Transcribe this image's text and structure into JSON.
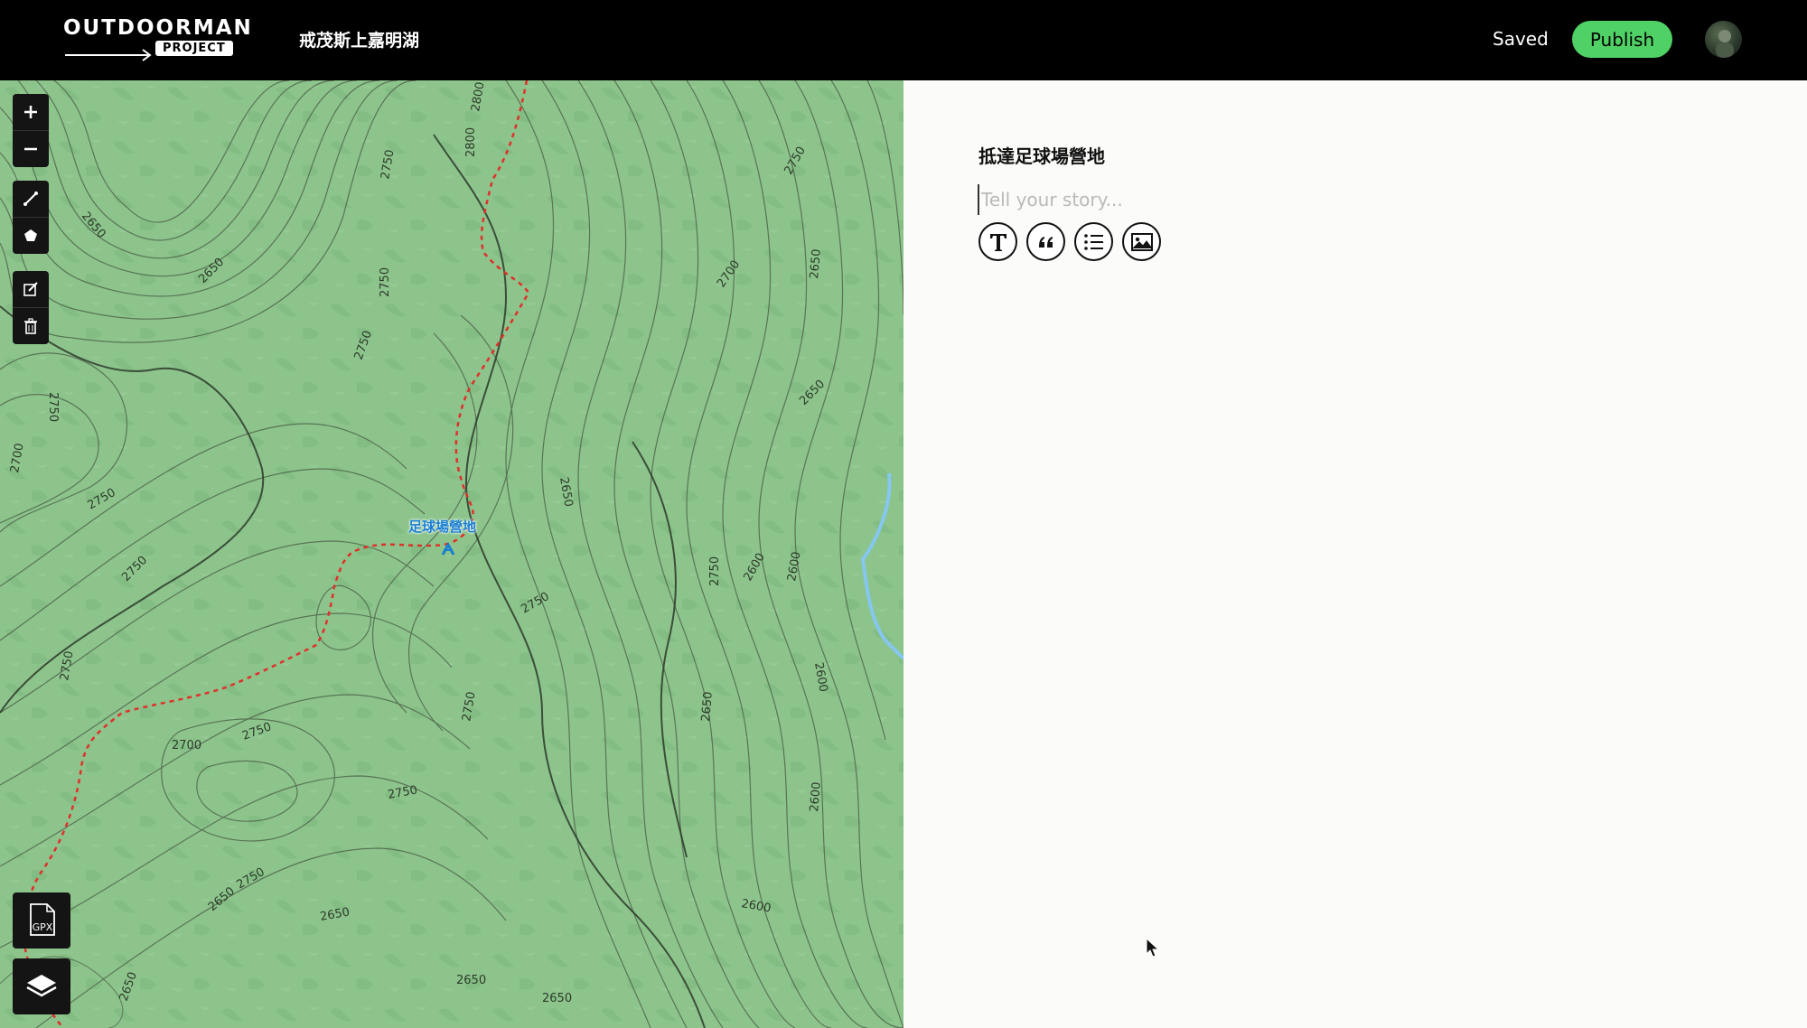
{
  "header": {
    "logo_main": "OUTDOORMAN",
    "logo_sub": "PROJECT",
    "trip_title": "戒茂斯上嘉明湖",
    "saved_label": "Saved",
    "publish_label": "Publish"
  },
  "map": {
    "toolbar": [
      "zoom-in-icon",
      "zoom-out-icon",
      "draw-line-icon",
      "draw-polygon-icon",
      "edit-icon",
      "trash-icon"
    ],
    "gpx_label": "GPX",
    "layers_icon": "layers-icon",
    "camp_label": "足球場營地",
    "contour_labels": [
      "2800",
      "2800",
      "2750",
      "2650",
      "2650",
      "2750",
      "2750",
      "2750",
      "2700",
      "2750",
      "2750",
      "2650",
      "2750",
      "2750",
      "2700",
      "2750",
      "2750",
      "2750",
      "2750",
      "2650",
      "2650",
      "2650",
      "2600",
      "2600",
      "2600",
      "2650",
      "2750",
      "2750",
      "2700",
      "2650",
      "2650",
      "2600",
      "2600",
      "2650",
      "2650"
    ],
    "colors": {
      "base": "#8cc48c",
      "contour": "#4a5a44",
      "trail": "#e0302a",
      "stream": "#86c7ef",
      "camp": "#1a7fd1"
    }
  },
  "editor": {
    "section_heading": "抵達足球場營地",
    "story_placeholder": "Tell your story...",
    "story_value": "",
    "format_buttons": [
      "text-icon",
      "quote-icon",
      "list-icon",
      "image-icon"
    ]
  },
  "colors": {
    "header_bg": "#000000",
    "publish_bg": "#4fd165",
    "editor_bg": "#fbfbf9"
  }
}
